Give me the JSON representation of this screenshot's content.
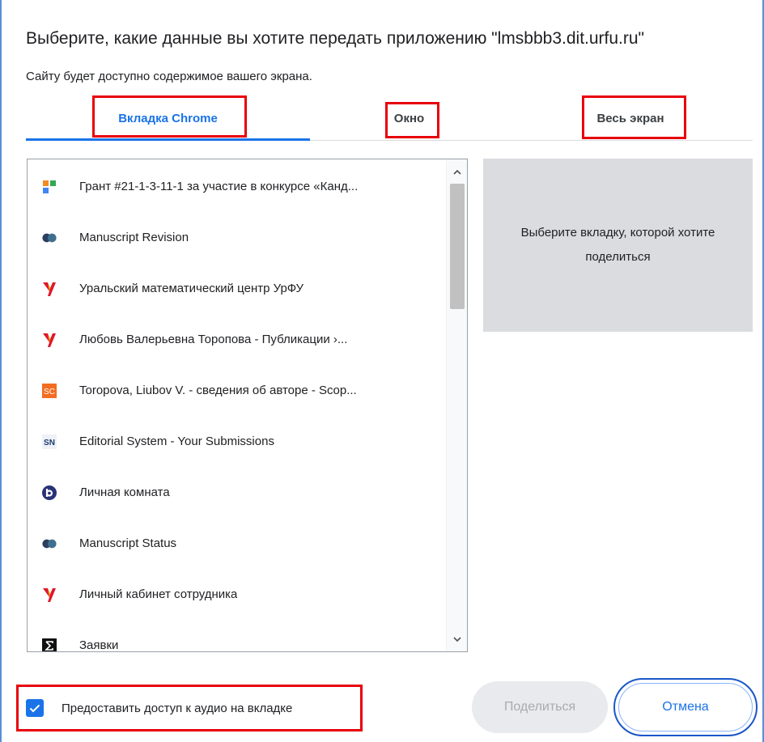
{
  "dialog": {
    "title": "Выберите, какие данные вы хотите передать приложению \"lmsbbb3.dit.urfu.ru\"",
    "subtitle": "Сайту будет доступно содержимое вашего экрана."
  },
  "tabs": [
    {
      "label": "Вкладка Chrome",
      "active": true
    },
    {
      "label": "Окно",
      "active": false
    },
    {
      "label": "Весь экран",
      "active": false
    }
  ],
  "tab_list": {
    "items": [
      {
        "icon": "grant-favicon-icon",
        "label": "Грант #21-1-3-11-1 за участие в конкурсе «Канд..."
      },
      {
        "icon": "manuscript-favicon-icon",
        "label": "Manuscript Revision"
      },
      {
        "icon": "urfu-favicon-icon",
        "label": "Уральский математический центр УрФУ"
      },
      {
        "icon": "urfu-favicon-icon",
        "label": "Любовь Валерьевна Торопова - Публикации ›..."
      },
      {
        "icon": "scopus-favicon-icon",
        "label": "Toropova, Liubov V. - сведения об авторе - Scop..."
      },
      {
        "icon": "springer-favicon-icon",
        "label": "Editorial System - Your Submissions"
      },
      {
        "icon": "bbb-favicon-icon",
        "label": "Личная комната"
      },
      {
        "icon": "manuscript-favicon-icon",
        "label": "Manuscript Status"
      },
      {
        "icon": "urfu-favicon-icon",
        "label": "Личный кабинет сотрудника"
      },
      {
        "icon": "sigma-favicon-icon",
        "label": "Заявки"
      }
    ],
    "scroll_position_fraction": 0.0
  },
  "preview": {
    "placeholder": "Выберите вкладку, которой хотите поделиться"
  },
  "audio": {
    "label": "Предоставить доступ к аудио на вкладке",
    "checked": true
  },
  "buttons": {
    "share": "Поделиться",
    "cancel": "Отмена"
  },
  "colors": {
    "accent": "#1a73e8",
    "highlight": "#e8000b",
    "preview_bg": "#dadce0"
  },
  "favicon_text": {
    "scopus": "SC",
    "springer": "SN"
  }
}
